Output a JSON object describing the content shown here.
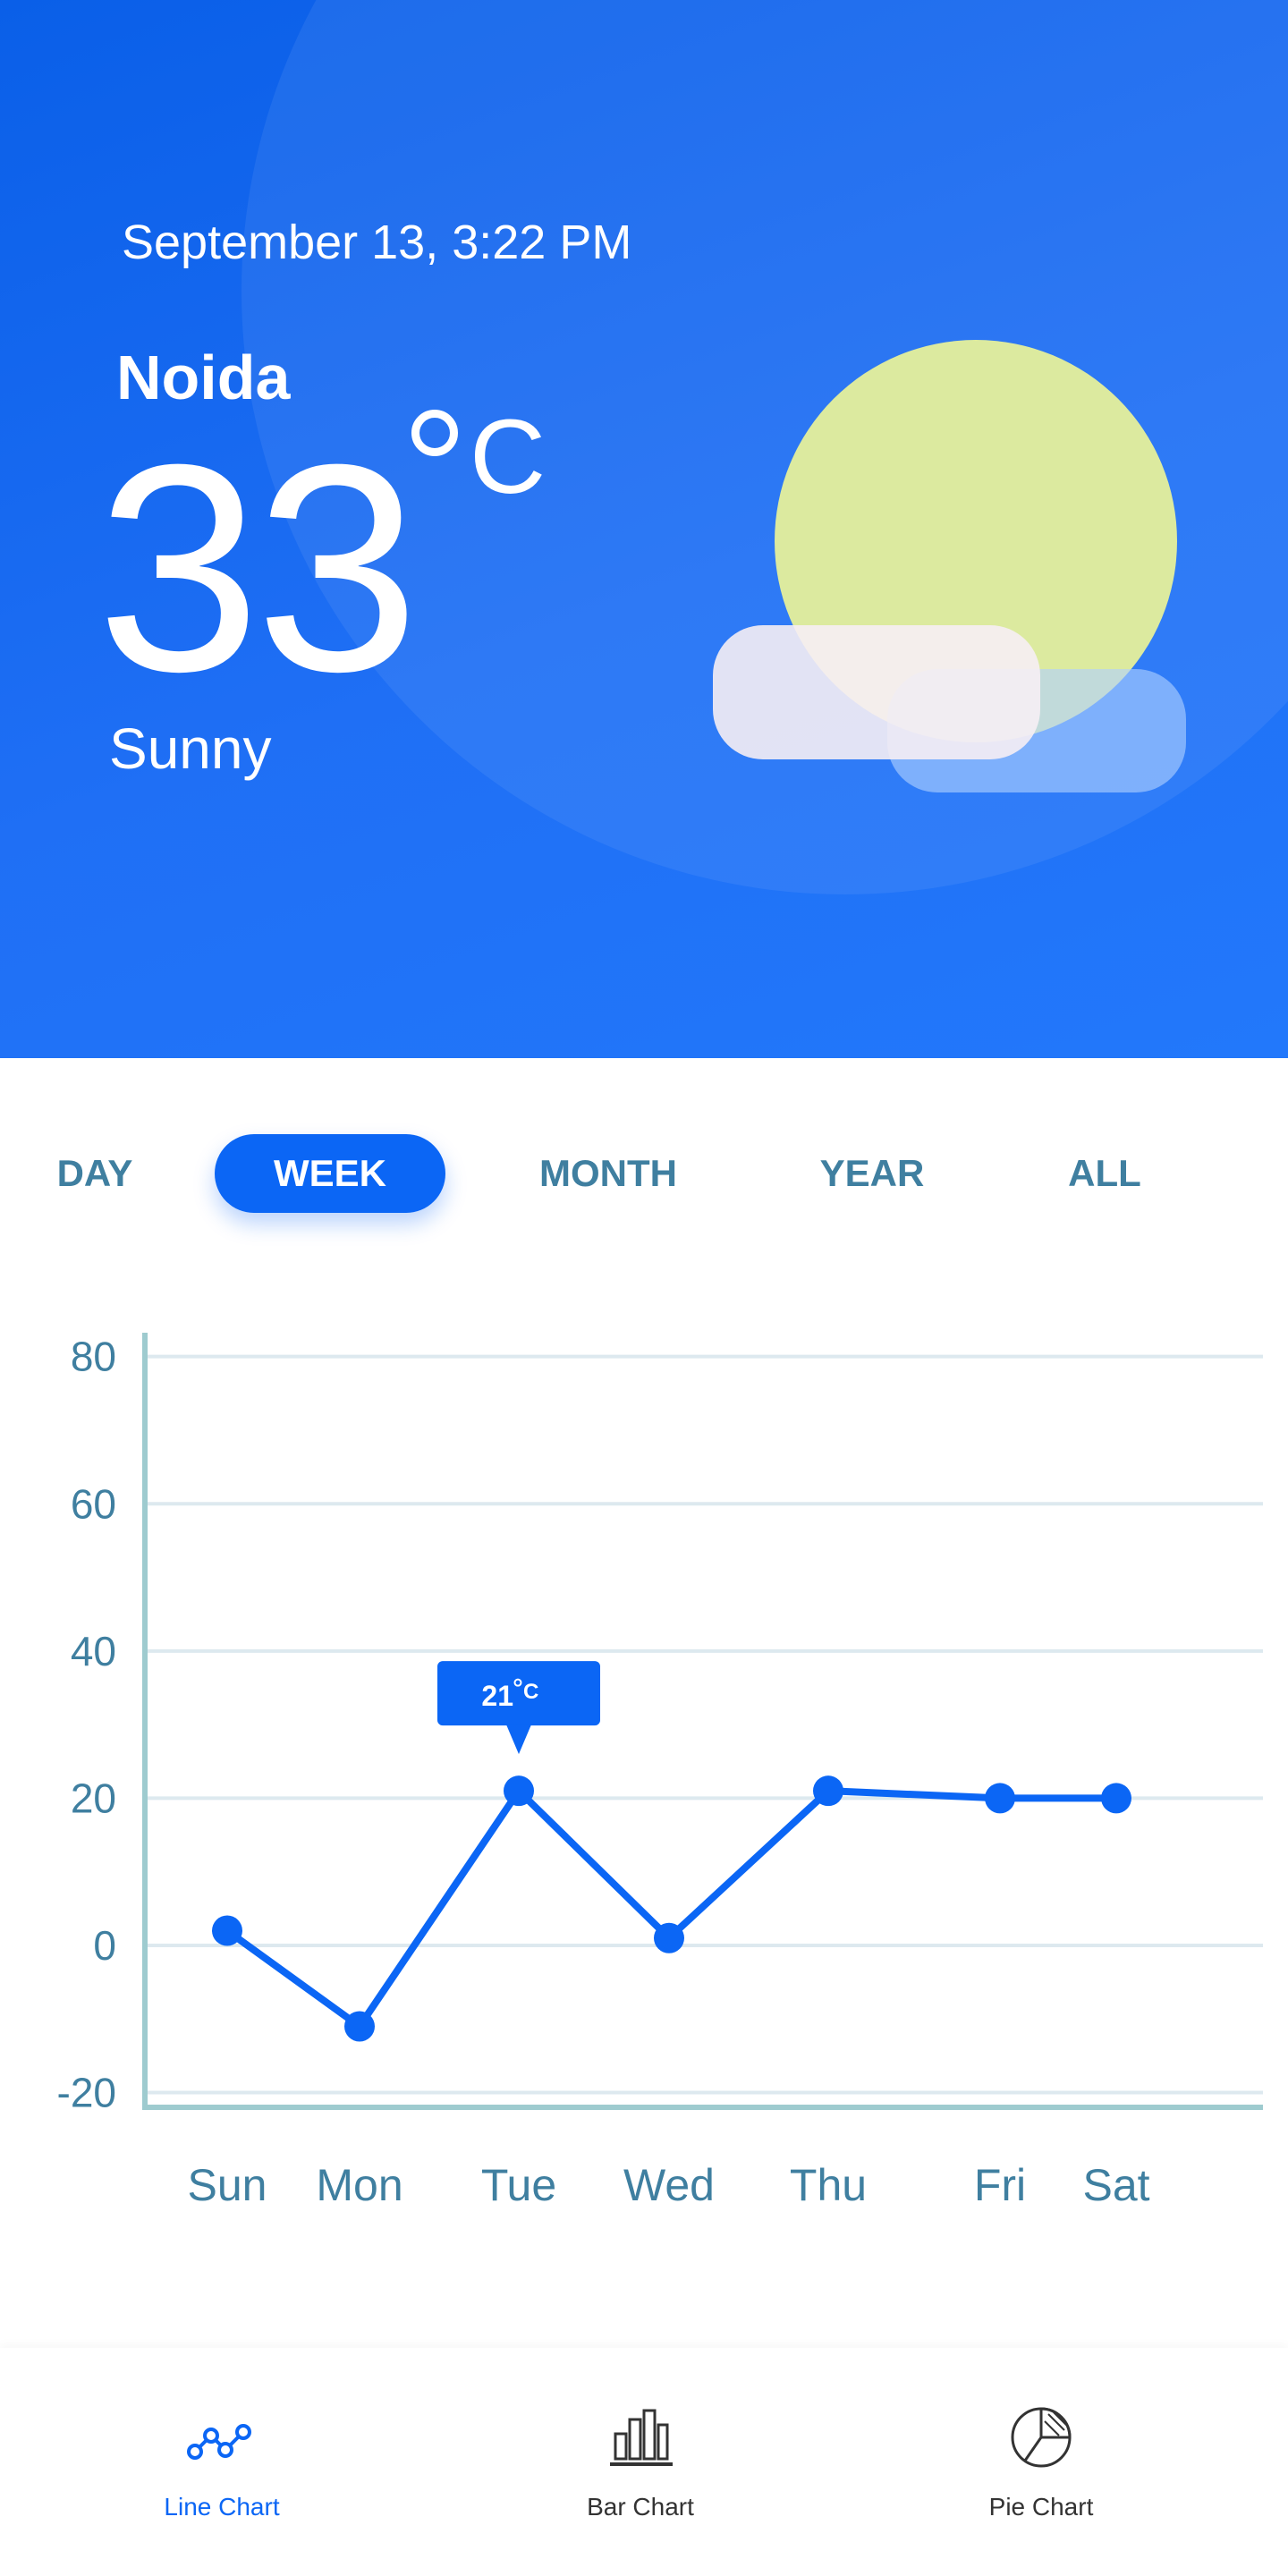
{
  "header": {
    "datetime": "September 13, 3:22 PM",
    "city": "Noida",
    "temperature": "33",
    "unit": "C",
    "condition": "Sunny",
    "weather_icon": "sun-cloud-icon"
  },
  "tabs": [
    {
      "label": "DAY",
      "active": false
    },
    {
      "label": "WEEK",
      "active": true
    },
    {
      "label": "MONTH",
      "active": false
    },
    {
      "label": "YEAR",
      "active": false
    },
    {
      "label": "ALL",
      "active": false
    }
  ],
  "chart_data": {
    "type": "line",
    "categories": [
      "Sun",
      "Mon",
      "Tue",
      "Wed",
      "Thu",
      "Fri",
      "Sat"
    ],
    "values": [
      2,
      -11,
      21,
      1,
      21,
      20,
      20
    ],
    "y_ticks": [
      "80",
      "60",
      "40",
      "20",
      "0",
      "-20"
    ],
    "ylim": [
      -22,
      83
    ],
    "grid": true,
    "tooltip": {
      "category": "Tue",
      "value": "21",
      "unit": "C"
    },
    "line_color": "#0b66f5"
  },
  "bottom_nav": [
    {
      "label": "Line Chart",
      "icon": "line-chart-icon",
      "active": true
    },
    {
      "label": "Bar Chart",
      "icon": "bar-chart-icon",
      "active": false
    },
    {
      "label": "Pie Chart",
      "icon": "pie-chart-icon",
      "active": false
    }
  ],
  "colors": {
    "primary": "#0b66f5",
    "axis": "#9ecbcf",
    "tick_text": "#3f7fa0",
    "sun": "#dcea9f"
  }
}
